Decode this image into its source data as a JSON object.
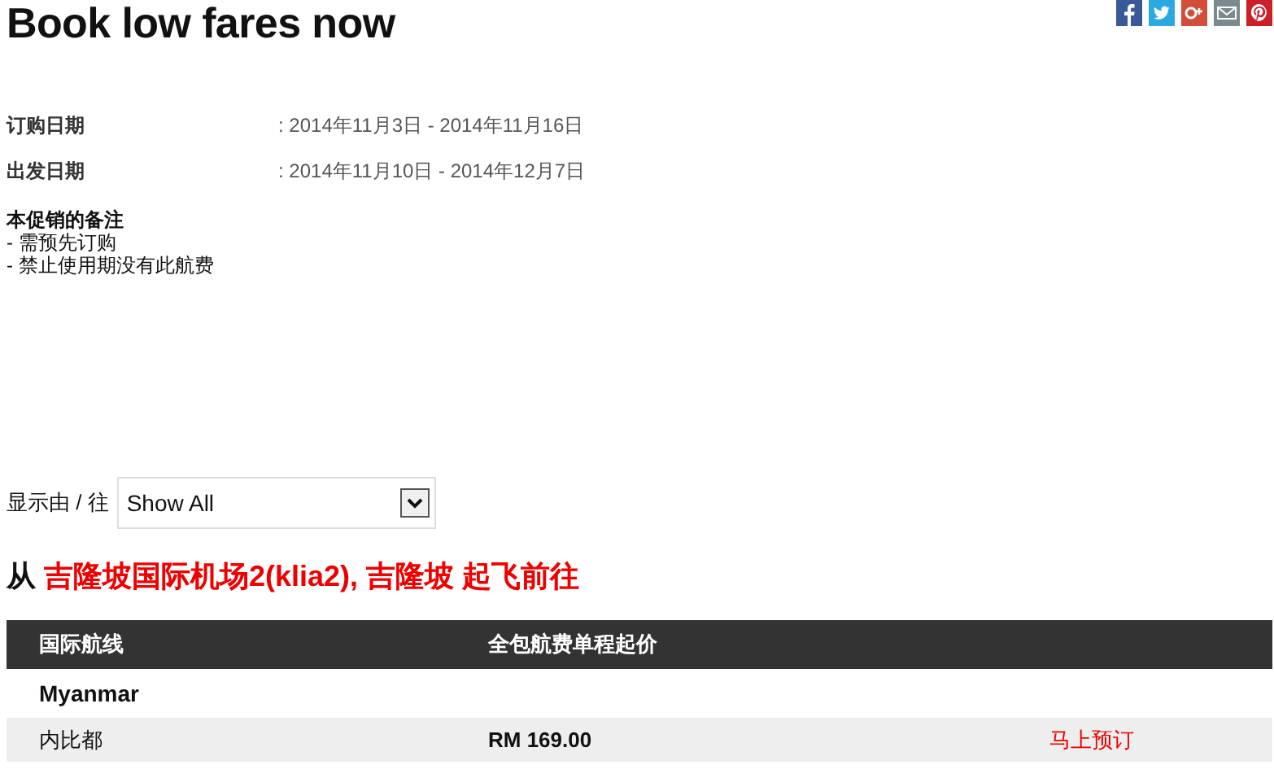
{
  "title": "Book low fares now",
  "share_icons": [
    {
      "kind": "facebook"
    },
    {
      "kind": "twitter"
    },
    {
      "kind": "googleplus"
    },
    {
      "kind": "email"
    },
    {
      "kind": "pinterest"
    }
  ],
  "details": [
    {
      "label": "订购日期",
      "value": ": 2014年11月3日 - 2014年11月16日"
    },
    {
      "label": "出发日期",
      "value": ": 2014年11月10日 - 2014年12月7日"
    }
  ],
  "notes": {
    "heading": "本促销的备注",
    "items": [
      "- 需预先订购",
      "- 禁止使用期没有此航费"
    ]
  },
  "filter": {
    "label": "显示由 / 往",
    "value": "Show All"
  },
  "origin": {
    "prefix": "从",
    "place": "吉隆坡国际机场2(klia2), 吉隆坡 起飞前往"
  },
  "table": {
    "columns": [
      "国际航线",
      "全包航费单程起价"
    ],
    "groups": [
      {
        "name": "Myanmar",
        "rows": [
          {
            "destination": "内比都",
            "price": "RM 169.00",
            "action": "马上预订"
          }
        ]
      }
    ]
  }
}
